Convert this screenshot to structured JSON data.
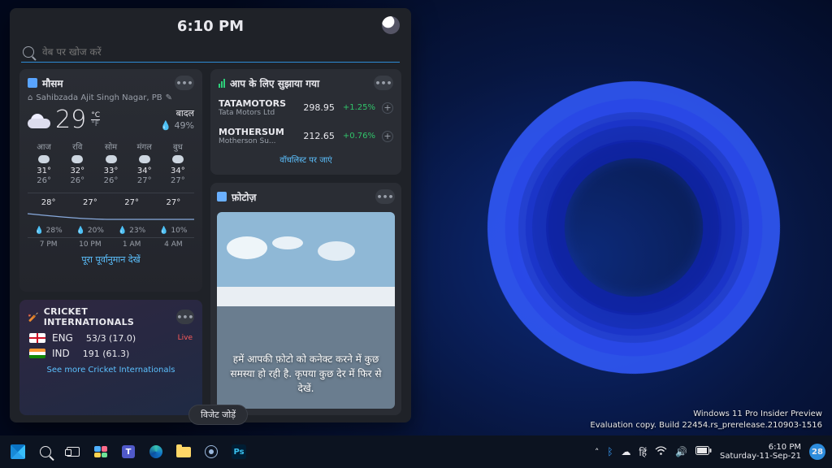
{
  "panel": {
    "time": "6:10 PM",
    "search_placeholder": "वेब पर खोज करें"
  },
  "weather": {
    "title": "मौसम",
    "location": "Sahibzada Ajit Singh Nagar, PB",
    "temp": "29",
    "unit_c": "°C",
    "unit_f": "°F",
    "condition": "बादल",
    "humidity_icon": "💧",
    "humidity": "49%",
    "days": [
      {
        "name": "आज",
        "hi": "31°",
        "lo": "26°"
      },
      {
        "name": "रवि",
        "hi": "32°",
        "lo": "26°"
      },
      {
        "name": "सोम",
        "hi": "33°",
        "lo": "26°"
      },
      {
        "name": "मंगल",
        "hi": "34°",
        "lo": "27°"
      },
      {
        "name": "बुध",
        "hi": "34°",
        "lo": "27°"
      }
    ],
    "hourly": [
      {
        "t": "28°",
        "p": "28%",
        "h": "7 PM"
      },
      {
        "t": "27°",
        "p": "20%",
        "h": "10 PM"
      },
      {
        "t": "27°",
        "p": "23%",
        "h": "1 AM"
      },
      {
        "t": "27°",
        "p": "10%",
        "h": "4 AM"
      }
    ],
    "link": "पूरा पूर्वानुमान देखें"
  },
  "cricket": {
    "title": "CRICKET INTERNATIONALS",
    "icon": "🏏",
    "live": "Live",
    "teams": [
      {
        "abbr": "ENG",
        "score": "53/3 (17.0)",
        "flag": "eng"
      },
      {
        "abbr": "IND",
        "score": "191 (61.3)",
        "flag": "ind"
      }
    ],
    "link": "See more Cricket Internationals"
  },
  "suggestions": {
    "title": "आप के लिए सुझाया गया",
    "stocks": [
      {
        "sym": "TATAMOTORS",
        "name": "Tata Motors Ltd",
        "price": "298.95",
        "chg": "+1.25%"
      },
      {
        "sym": "MOTHERSUM",
        "name": "Motherson Su...",
        "price": "212.65",
        "chg": "+0.76%"
      }
    ],
    "link": "वॉचलिस्ट पर जाएं"
  },
  "photos": {
    "title": "फ़ोटोज़",
    "message": "हमें आपकी फ़ोटो को कनेक्ट करने में कुछ समस्या हो रही है. कृपया कुछ देर में फिर से देखें."
  },
  "add_widget": "विजेट जोड़ें",
  "insider": {
    "l1": "Windows 11 Pro Insider Preview",
    "l2": "Evaluation copy. Build 22454.rs_prerelease.210903-1516"
  },
  "taskbar": {
    "ps": "Ps",
    "lang": "हिं",
    "time": "6:10 PM",
    "date": "Saturday-11-Sep-21",
    "badge": "28"
  }
}
